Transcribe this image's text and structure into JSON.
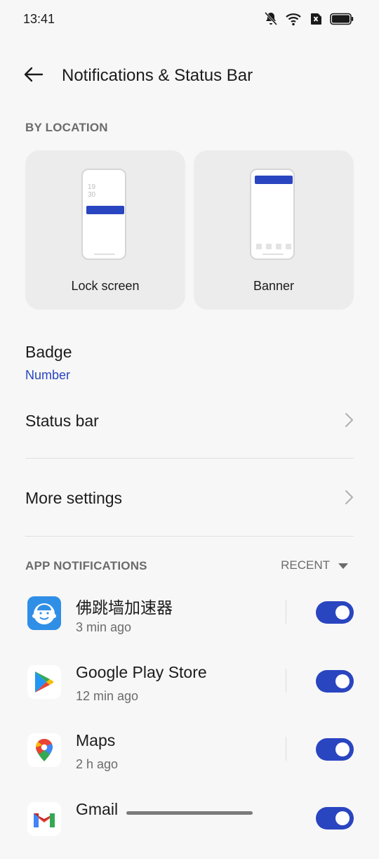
{
  "status_bar": {
    "time": "13:41",
    "icons": [
      "bell-off-icon",
      "wifi-icon",
      "no-sim-icon",
      "battery-icon"
    ]
  },
  "header": {
    "title": "Notifications & Status Bar",
    "back_icon": "back-arrow-icon"
  },
  "by_location": {
    "label": "BY LOCATION",
    "cards": [
      {
        "label": "Lock screen",
        "preview_clock": [
          "19",
          "30"
        ]
      },
      {
        "label": "Banner"
      }
    ]
  },
  "badge": {
    "title": "Badge",
    "value": "Number"
  },
  "status_bar_row": {
    "title": "Status bar"
  },
  "more_settings_row": {
    "title": "More settings"
  },
  "app_notifications": {
    "label": "APP NOTIFICATIONS",
    "sort_label": "RECENT",
    "apps": [
      {
        "name": "佛跳墙加速器",
        "time": "3 min ago",
        "enabled": true,
        "icon": "buddha-app-icon"
      },
      {
        "name": "Google Play Store",
        "time": "12 min ago",
        "enabled": true,
        "icon": "google-play-icon"
      },
      {
        "name": "Maps",
        "time": "2 h ago",
        "enabled": true,
        "icon": "google-maps-icon"
      },
      {
        "name": "Gmail",
        "time": "",
        "enabled": true,
        "icon": "gmail-icon"
      }
    ]
  },
  "colors": {
    "accent": "#2a45c0",
    "background": "#f7f7f7",
    "card": "#ececec"
  }
}
